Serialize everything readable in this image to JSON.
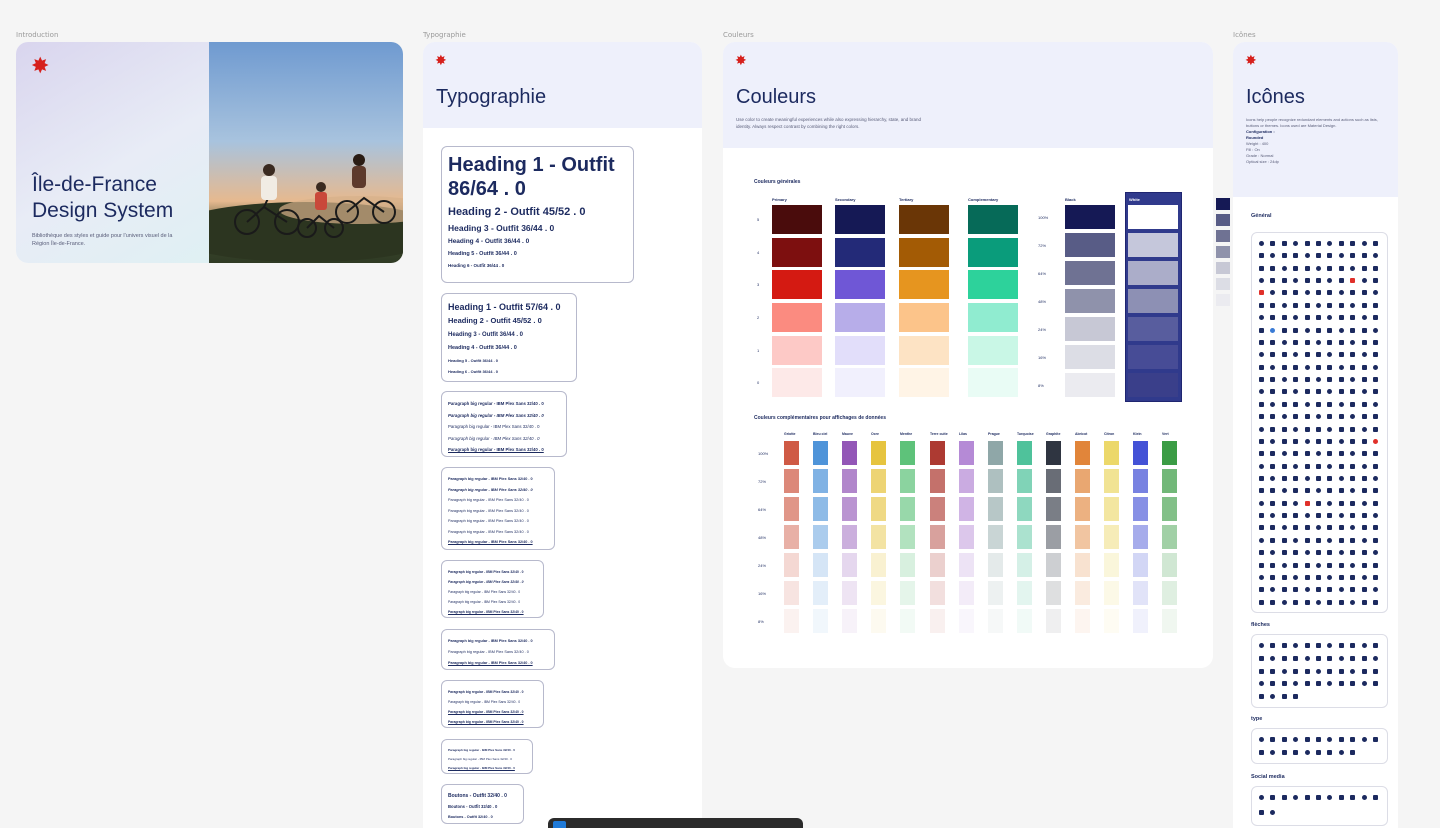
{
  "frames": {
    "intro_label": "Introduction",
    "typo_label": "Typographie",
    "colors_label": "Couleurs",
    "icons_label": "Icônes"
  },
  "intro": {
    "title_line1": "Île-de-France",
    "title_line2": "Design System",
    "description": "Bibliothèque des styles et guide pour l'univers visuel de la Région Île-de-France."
  },
  "typography": {
    "title": "Typographie",
    "box1": [
      "Heading 1 - Outfit",
      "86/64 . 0",
      "Heading 2 - Outfit 45/52 . 0",
      "Heading 3 - Outfit 36/44 . 0",
      "Heading 4 - Outfit 36/44 . 0",
      "Heading 5 - Outfit 36/44 . 0",
      "Heading 6 - Outfit 36/44 . 0"
    ],
    "box2": [
      "Heading 1 - Outfit 57/64 . 0",
      "Heading 2 - Outfit 45/52 . 0",
      "Heading 3 - Outfit 36/44 . 0",
      "Heading 4 - Outfit 36/44 . 0",
      "Heading 5 - Outfit 36/44 . 0",
      "Heading 6 - Outfit 36/44 . 0"
    ],
    "para": "Paragraph big regular - IBM Plex Sans 32/40 . 0",
    "buttons": [
      "Boutons - Outfit 32/40 . 0",
      "Boutons - Outfit 32/40 . 0",
      "Boutons - Outfit 32/40 . 0"
    ]
  },
  "colors": {
    "title": "Couleurs",
    "description": "Use color to create meaningful experiences while also expressing hierarchy, state, and brand identity. Always respect contrast by combining the right colors.",
    "general_title": "Couleurs générales",
    "columns": [
      "Primary",
      "Secondary",
      "Tertiary",
      "Complementary"
    ],
    "row_labels": [
      "5",
      "4",
      "3",
      "2",
      "1",
      "0"
    ],
    "opacity_labels": [
      "100%",
      "72%",
      "64%",
      "48%",
      "24%",
      "16%",
      "8%"
    ],
    "black_label": "Black",
    "white_label": "White",
    "palette": {
      "Primary": [
        "#4a0c0c",
        "#7d0f0f",
        "#d41a12",
        "#fb8b80",
        "#fdc9c6",
        "#fde9e8"
      ],
      "Secondary": [
        "#151955",
        "#232a78",
        "#6f57d6",
        "#b7ade9",
        "#e2defa",
        "#f1f0fd"
      ],
      "Tertiary": [
        "#6a3606",
        "#a35b05",
        "#e6951f",
        "#fcc48a",
        "#fde3c4",
        "#fff4e6"
      ],
      "Complementary": [
        "#066a58",
        "#0a9c7b",
        "#2dd29b",
        "#90ecd0",
        "#c9f7e6",
        "#e9fcf5"
      ]
    },
    "black_shades": [
      "#151955",
      "#585c86",
      "#6f7293",
      "#8f92ab",
      "#c7c8d5",
      "#dcdde5",
      "#ebebf0"
    ],
    "white_shades": [
      "#ffffff",
      "#c5c7db",
      "#abadc9",
      "#8d90b4",
      "#585d9e",
      "#474c96",
      "#3a3f8a"
    ],
    "extra_title": "Couleurs complémentaires pour affichages de données",
    "extra_names": [
      "Griotte",
      "Bleu ciel",
      "Mauve",
      "Ocre",
      "Menthe",
      "Terre cuite",
      "Lilas",
      "Prague",
      "Turquoise",
      "Graphite",
      "Abricot",
      "Citron",
      "Klein",
      "Vert"
    ],
    "extra_colors": [
      "#cf5a45",
      "#4f94d9",
      "#9357b7",
      "#e6c43f",
      "#5ec27a",
      "#ad3a32",
      "#b58ad6",
      "#8fa7a8",
      "#4fc29b",
      "#2f3541",
      "#e1853a",
      "#ecd86a",
      "#4452d6",
      "#3b9c45"
    ],
    "extra_opacity_labels": [
      "100%",
      "72%",
      "64%",
      "48%",
      "24%",
      "16%",
      "8%"
    ]
  },
  "icons": {
    "title": "Icônes",
    "description": "Icons help people recognize redundant elements and actions such as lists, buttons or themes. Icons used are Material Design.",
    "config_label": "Configuration :",
    "config_lines": [
      "Rounded",
      "Weight : 400",
      "Fill : On",
      "Grade : Normal",
      "Optical size : 24dp"
    ],
    "sections": [
      "Général",
      "flèches",
      "type",
      "Social media"
    ]
  }
}
